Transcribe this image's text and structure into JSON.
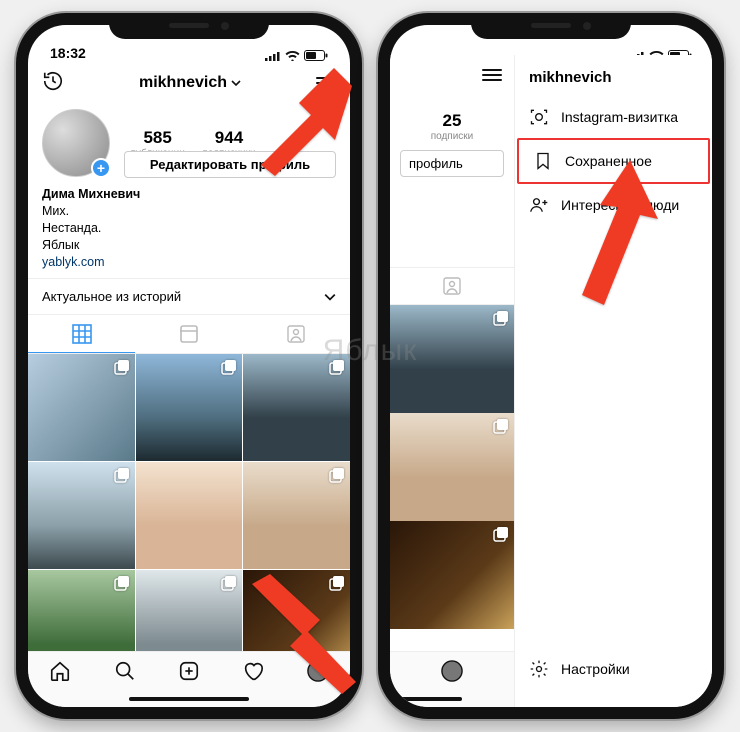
{
  "status": {
    "time": "18:32"
  },
  "left": {
    "username": "mikhnevich",
    "stats": {
      "posts": {
        "num": "585",
        "label": "публикации"
      },
      "followers": {
        "num": "944",
        "label": "подписчики"
      },
      "following_hidden": true
    },
    "edit_button": "Редактировать профиль",
    "bio": {
      "name": "Дима Михневич",
      "line1": "Мих.",
      "line2": "Нестанда.",
      "line3": "Яблык",
      "link": "yablyk.com"
    },
    "highlights_label": "Актуальное из историй"
  },
  "right": {
    "visible_stat": {
      "num": "25",
      "label": "подписки"
    },
    "visible_button_fragment": "профиль",
    "panel_title": "mikhnevich",
    "items": {
      "nametag": "Instagram-визитка",
      "saved": "Сохраненное",
      "discover": "Интересные люди"
    },
    "settings": "Настройки"
  },
  "watermark": "Яблык"
}
